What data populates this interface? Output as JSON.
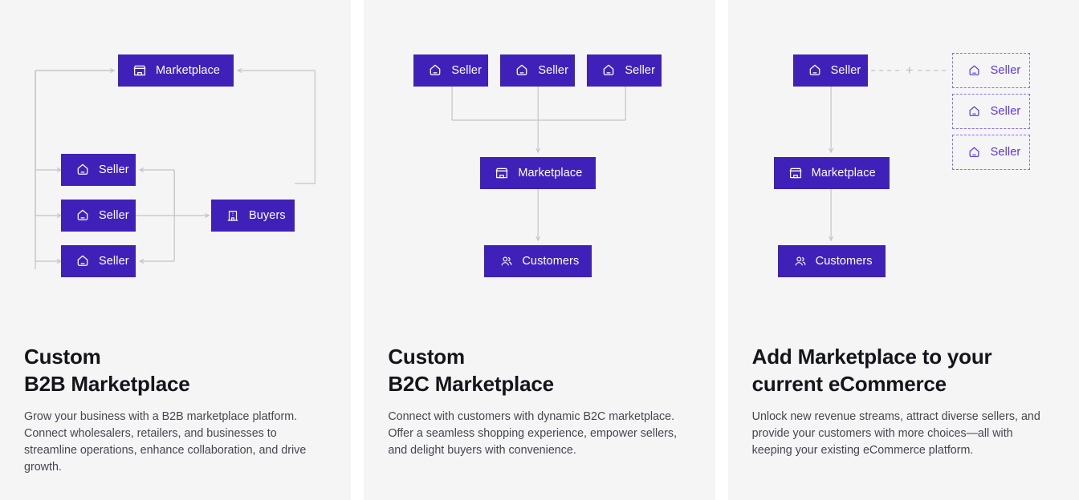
{
  "theme": {
    "node_fill": "#3f21ba",
    "node_text": "#ffffff",
    "ghost_border": "#8a6ef0",
    "ghost_text": "#5b36dd",
    "wire": "#c4c4c7",
    "card_bg": "#f5f5f6",
    "page_bg": "#ffffff",
    "heading_color": "#14151a",
    "body_color": "#45474f"
  },
  "cards": [
    {
      "id": "b2b",
      "heading_lines": [
        "Custom",
        "B2B Marketplace"
      ],
      "body": "Grow your business with a B2B marketplace platform. Connect wholesalers, retailers, and businesses to streamline operations, enhance collaboration, and drive growth.",
      "nodes": [
        {
          "id": "marketplace",
          "label": "Marketplace",
          "icon": "storefront-icon",
          "style": "solid"
        },
        {
          "id": "seller-1",
          "label": "Seller",
          "icon": "seller-icon",
          "style": "solid"
        },
        {
          "id": "seller-2",
          "label": "Seller",
          "icon": "seller-icon",
          "style": "solid"
        },
        {
          "id": "seller-3",
          "label": "Seller",
          "icon": "seller-icon",
          "style": "solid"
        },
        {
          "id": "buyers",
          "label": "Buyers",
          "icon": "building-icon",
          "style": "solid"
        }
      ]
    },
    {
      "id": "b2c",
      "heading_lines": [
        "Custom",
        "B2C Marketplace"
      ],
      "body": "Connect with customers with dynamic B2C marketplace. Offer a seamless shopping experience, empower sellers, and delight buyers with convenience.",
      "nodes": [
        {
          "id": "seller-1",
          "label": "Seller",
          "icon": "seller-icon",
          "style": "solid"
        },
        {
          "id": "seller-2",
          "label": "Seller",
          "icon": "seller-icon",
          "style": "solid"
        },
        {
          "id": "seller-3",
          "label": "Seller",
          "icon": "seller-icon",
          "style": "solid"
        },
        {
          "id": "marketplace",
          "label": "Marketplace",
          "icon": "storefront-icon",
          "style": "solid"
        },
        {
          "id": "customers",
          "label": "Customers",
          "icon": "people-icon",
          "style": "solid"
        }
      ]
    },
    {
      "id": "add-marketplace",
      "heading_lines": [
        "Add Marketplace to your",
        "current eCommerce"
      ],
      "body": "Unlock new revenue streams, attract diverse sellers, and provide your customers with more choices—all with keeping your existing eCommerce platform.",
      "plus_symbol": "+",
      "nodes": [
        {
          "id": "seller-main",
          "label": "Seller",
          "icon": "seller-icon",
          "style": "solid"
        },
        {
          "id": "marketplace",
          "label": "Marketplace",
          "icon": "storefront-icon",
          "style": "solid"
        },
        {
          "id": "customers",
          "label": "Customers",
          "icon": "people-icon",
          "style": "solid"
        },
        {
          "id": "ghost-seller-1",
          "label": "Seller",
          "icon": "seller-icon",
          "style": "dashed"
        },
        {
          "id": "ghost-seller-2",
          "label": "Seller",
          "icon": "seller-icon",
          "style": "dashed"
        },
        {
          "id": "ghost-seller-3",
          "label": "Seller",
          "icon": "seller-icon",
          "style": "dashed"
        }
      ]
    }
  ]
}
